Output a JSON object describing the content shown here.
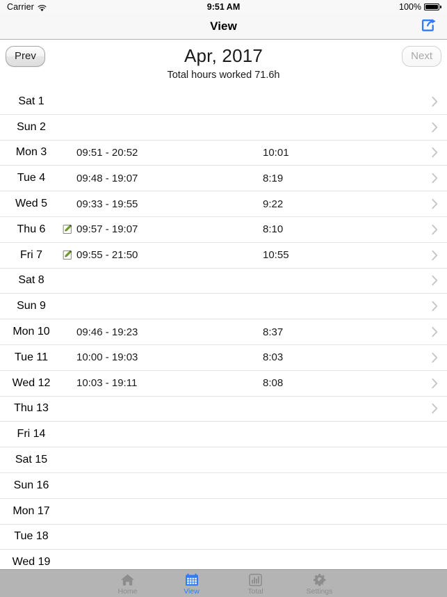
{
  "status_bar": {
    "carrier": "Carrier",
    "wifi_icon": "wifi-icon",
    "time": "9:51 AM",
    "battery_percent": "100%",
    "battery_icon": "battery-full-icon"
  },
  "nav_bar": {
    "title": "View",
    "share_icon": "share-icon"
  },
  "month_header": {
    "prev_label": "Prev",
    "next_label": "Next",
    "month_title": "Apr, 2017",
    "total_line": "Total hours worked 71.6h"
  },
  "colors": {
    "accent": "#2f7cf6",
    "tabbar_bg": "#b4b4b4",
    "separator": "#e3e3e3",
    "navbar_bg": "#f7f7f7",
    "pencil_green": "#5a8a21"
  },
  "list": {
    "rows": [
      {
        "day": "Sat 1",
        "range": "",
        "duration": "",
        "edited": false,
        "chevron": true
      },
      {
        "day": "Sun 2",
        "range": "",
        "duration": "",
        "edited": false,
        "chevron": true
      },
      {
        "day": "Mon 3",
        "range": "09:51 - 20:52",
        "duration": "10:01",
        "edited": false,
        "chevron": true
      },
      {
        "day": "Tue 4",
        "range": "09:48 - 19:07",
        "duration": "8:19",
        "edited": false,
        "chevron": true
      },
      {
        "day": "Wed 5",
        "range": "09:33 - 19:55",
        "duration": "9:22",
        "edited": false,
        "chevron": true
      },
      {
        "day": "Thu 6",
        "range": "09:57 - 19:07",
        "duration": "8:10",
        "edited": true,
        "chevron": true
      },
      {
        "day": "Fri 7",
        "range": "09:55 - 21:50",
        "duration": "10:55",
        "edited": true,
        "chevron": true
      },
      {
        "day": "Sat 8",
        "range": "",
        "duration": "",
        "edited": false,
        "chevron": true
      },
      {
        "day": "Sun 9",
        "range": "",
        "duration": "",
        "edited": false,
        "chevron": true
      },
      {
        "day": "Mon 10",
        "range": "09:46 - 19:23",
        "duration": "8:37",
        "edited": false,
        "chevron": true
      },
      {
        "day": "Tue 11",
        "range": "10:00 - 19:03",
        "duration": "8:03",
        "edited": false,
        "chevron": true
      },
      {
        "day": "Wed 12",
        "range": "10:03 - 19:11",
        "duration": "8:08",
        "edited": false,
        "chevron": true
      },
      {
        "day": "Thu 13",
        "range": "",
        "duration": "",
        "edited": false,
        "chevron": true
      },
      {
        "day": "Fri 14",
        "range": "",
        "duration": "",
        "edited": false,
        "chevron": false
      },
      {
        "day": "Sat 15",
        "range": "",
        "duration": "",
        "edited": false,
        "chevron": false
      },
      {
        "day": "Sun 16",
        "range": "",
        "duration": "",
        "edited": false,
        "chevron": false
      },
      {
        "day": "Mon 17",
        "range": "",
        "duration": "",
        "edited": false,
        "chevron": false
      },
      {
        "day": "Tue 18",
        "range": "",
        "duration": "",
        "edited": false,
        "chevron": false
      },
      {
        "day": "Wed 19",
        "range": "",
        "duration": "",
        "edited": false,
        "chevron": false
      }
    ]
  },
  "tab_bar": {
    "tabs": [
      {
        "label": "Home",
        "icon": "home-icon",
        "active": false
      },
      {
        "label": "View",
        "icon": "calendar-icon",
        "active": true
      },
      {
        "label": "Total",
        "icon": "bar-chart-icon",
        "active": false
      },
      {
        "label": "Settings",
        "icon": "gears-icon",
        "active": false
      }
    ]
  }
}
